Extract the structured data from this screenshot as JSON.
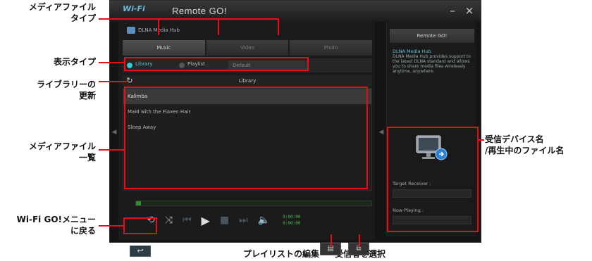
{
  "callouts": {
    "media_type_line1": "メディアファイル",
    "media_type_line2": "タイプ",
    "view_type": "表示タイプ",
    "refresh_line1": "ライブラリーの",
    "refresh_line2": "更新",
    "media_list_line1": "メディアファイル",
    "media_list_line2": "一覧",
    "back_line1": "Wi-Fi GO!メニュー",
    "back_line2": "に戻る",
    "playlist_edit": "プレイリストの編集",
    "select_receiver": "受信者を選択",
    "receiver_line1": "受信デバイス名",
    "receiver_line2": "/再生中のファイル名"
  },
  "app": {
    "logo": "Wi-Fi",
    "title": "Remote GO!",
    "minimize": "–",
    "close": "×"
  },
  "main": {
    "hub_title": "DLNA Media Hub",
    "tabs": [
      "Music",
      "Video",
      "Photo"
    ],
    "view": {
      "library": "Library",
      "playlist": "Playlist",
      "dropdown": "Default"
    },
    "library_bar": "Library",
    "files": [
      "Kalimba",
      "Maid with the Flaxen Hair",
      "Sleep Away"
    ],
    "progress": 0.02,
    "time_current": "0:00:00",
    "time_total": "0:00:00"
  },
  "right_panel": {
    "title": "Remote GO!",
    "heading": "DLNA Media Hub",
    "description": "DLNA Media Hub provides support to the latest DLNA standard and allows you to share media files wirelessly anytime, anywhere.",
    "target_label": "Target Receiver :",
    "now_playing_label": "Now Playing :"
  }
}
